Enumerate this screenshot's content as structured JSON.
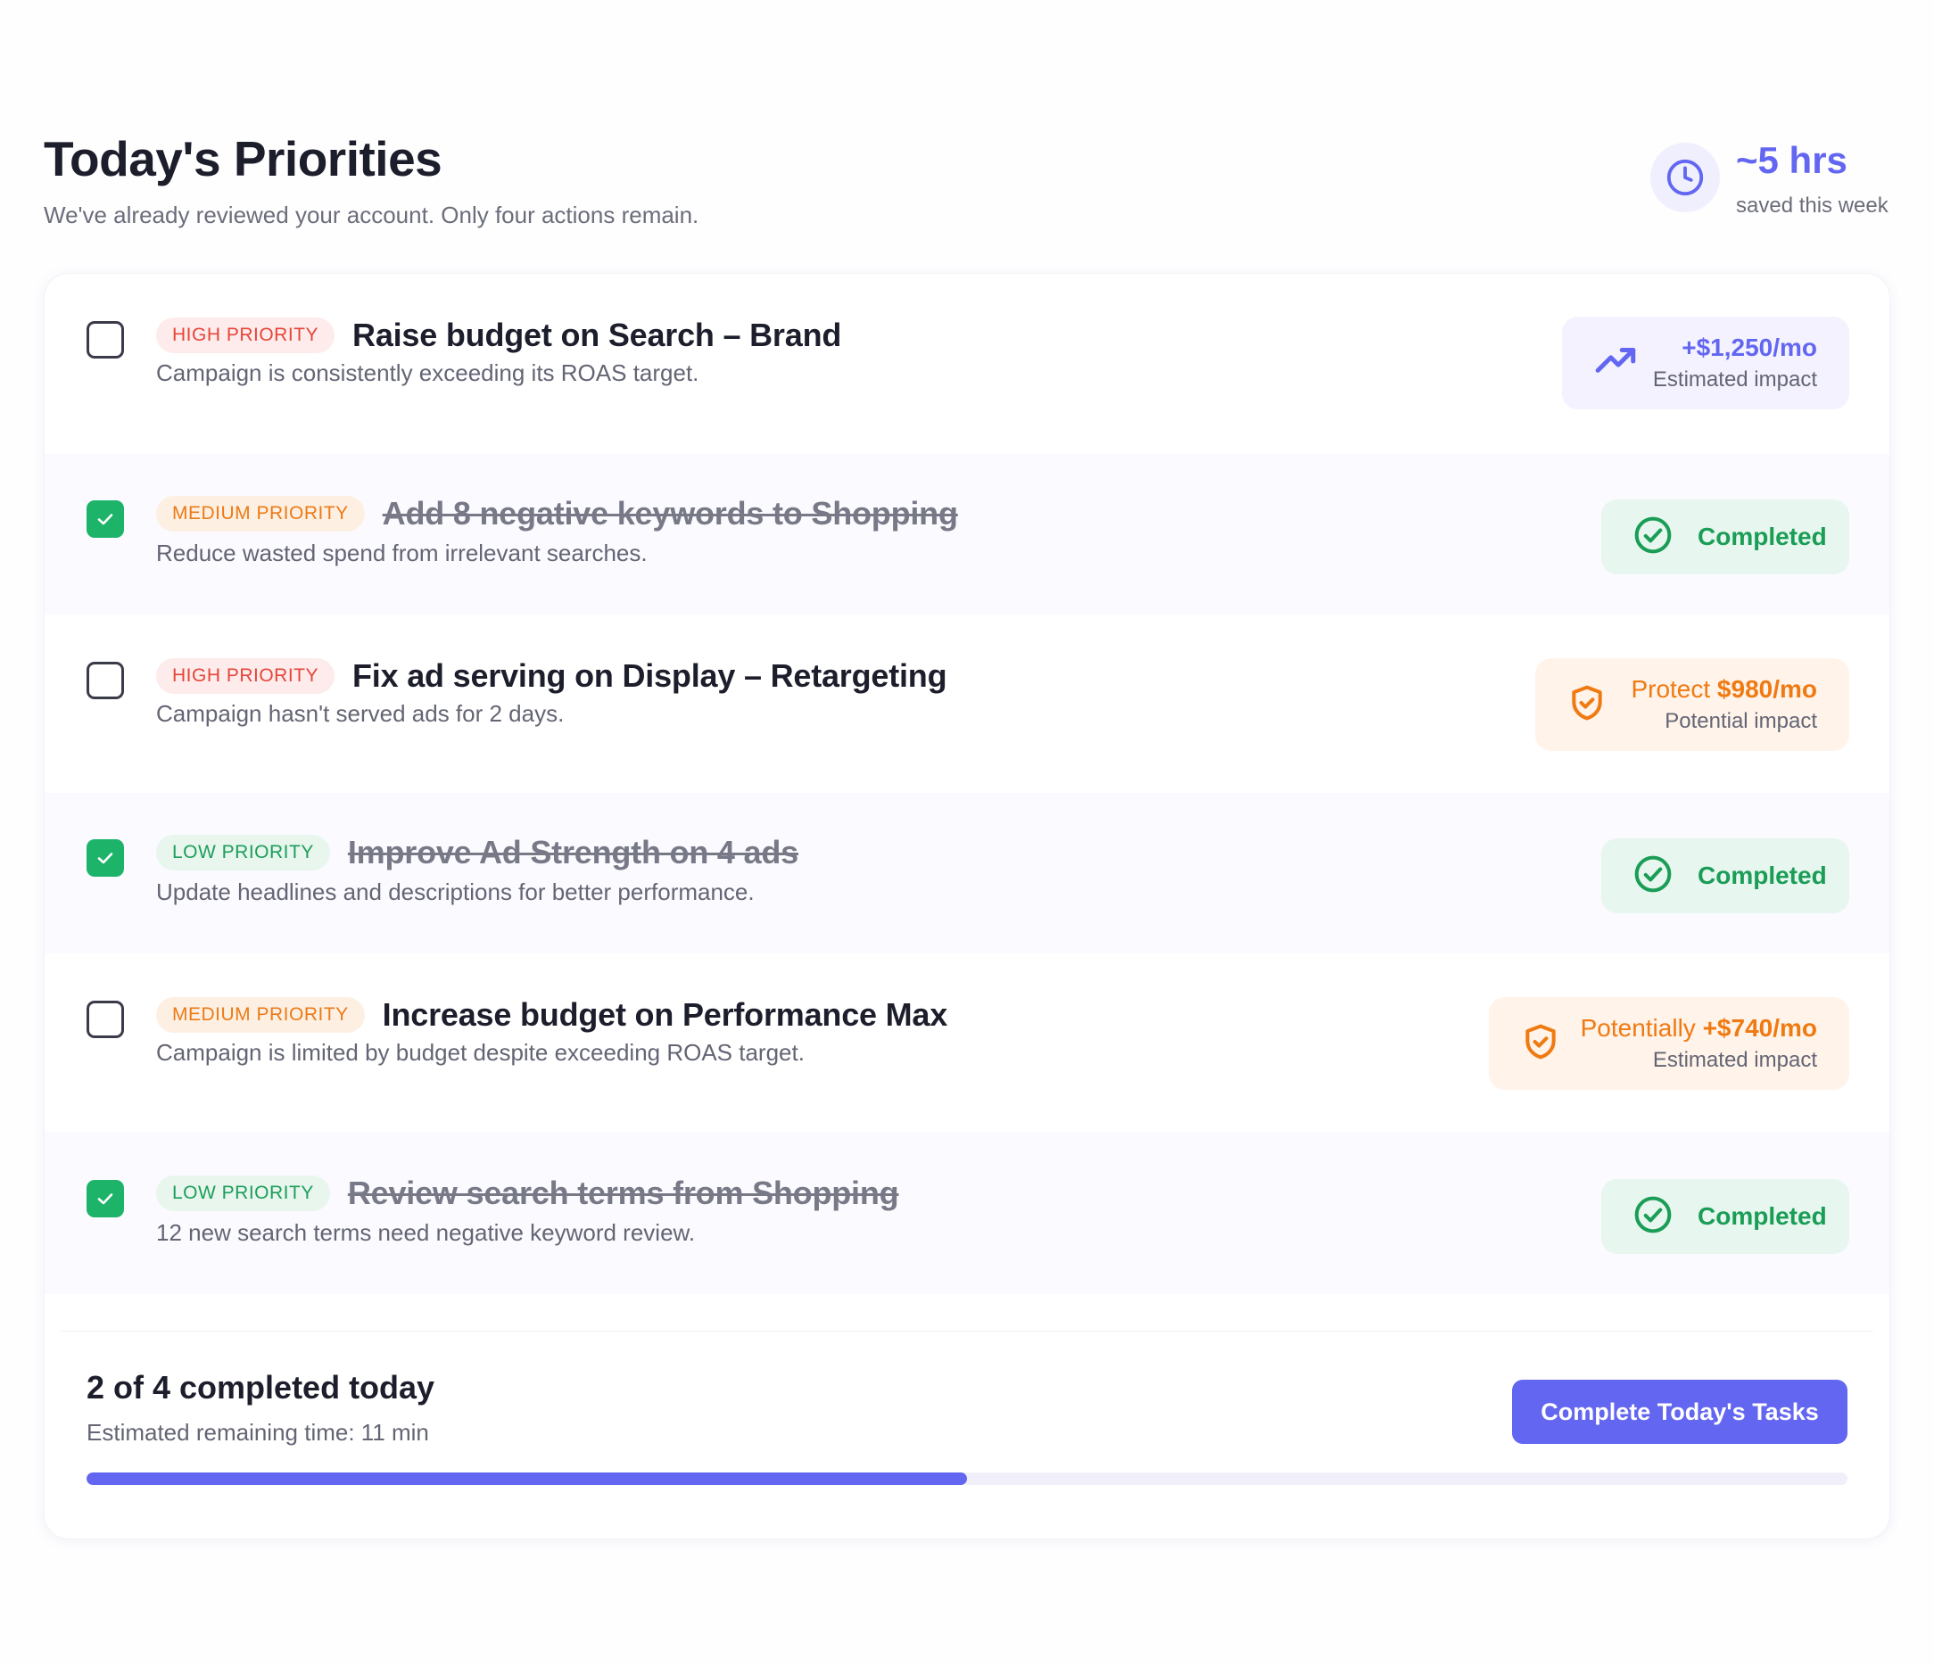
{
  "header": {
    "title": "Today's Priorities",
    "subtitle": "We've already reviewed your account. Only four actions remain."
  },
  "saved": {
    "value": "~5 hrs",
    "label": "saved this week",
    "icon": "clock-icon"
  },
  "tasks": [
    {
      "checked": false,
      "priority": "HIGH PRIORITY",
      "priority_level": "high",
      "title": "Raise budget on Search – Brand",
      "description": "Campaign is consistently exceeding its ROAS target.",
      "impact": {
        "type": "purple",
        "icon": "trending-up-icon",
        "prefix": "",
        "value": "+$1,250/mo",
        "label": "Estimated impact"
      }
    },
    {
      "checked": true,
      "priority": "MEDIUM PRIORITY",
      "priority_level": "medium",
      "title": "Add 8 negative keywords to Shopping",
      "description": "Reduce wasted spend from irrelevant searches.",
      "impact": {
        "type": "green",
        "icon": "check-circle-icon",
        "label": "Completed"
      }
    },
    {
      "checked": false,
      "priority": "HIGH PRIORITY",
      "priority_level": "high",
      "title": "Fix ad serving on Display – Retargeting",
      "description": "Campaign hasn't served ads for 2 days.",
      "impact": {
        "type": "orange",
        "icon": "shield-icon",
        "prefix": "Protect ",
        "value": "$980/mo",
        "label": "Potential impact"
      }
    },
    {
      "checked": true,
      "priority": "LOW PRIORITY",
      "priority_level": "low",
      "title": "Improve Ad Strength on 4 ads",
      "description": "Update headlines and descriptions for better performance.",
      "impact": {
        "type": "green",
        "icon": "check-circle-icon",
        "label": "Completed"
      }
    },
    {
      "checked": false,
      "priority": "MEDIUM PRIORITY",
      "priority_level": "medium",
      "title": "Increase budget on Performance Max",
      "description": "Campaign is limited by budget despite exceeding ROAS target.",
      "impact": {
        "type": "orange",
        "icon": "shield-icon",
        "prefix": "Potentially ",
        "value": "+$740/mo",
        "label": "Estimated impact"
      }
    },
    {
      "checked": true,
      "priority": "LOW PRIORITY",
      "priority_level": "low",
      "title": "Review search terms from Shopping",
      "description": "12 new search terms need negative keyword review.",
      "impact": {
        "type": "green",
        "icon": "check-circle-icon",
        "label": "Completed"
      }
    }
  ],
  "footer": {
    "summary": "2 of 4 completed today",
    "remaining": "Estimated remaining time: 11 min",
    "cta": "Complete Today's Tasks",
    "progress_fraction": 0.5
  },
  "colors": {
    "accent": "#6366f1",
    "success": "#1db46a",
    "warning": "#f07a12",
    "danger": "#e5453a"
  }
}
